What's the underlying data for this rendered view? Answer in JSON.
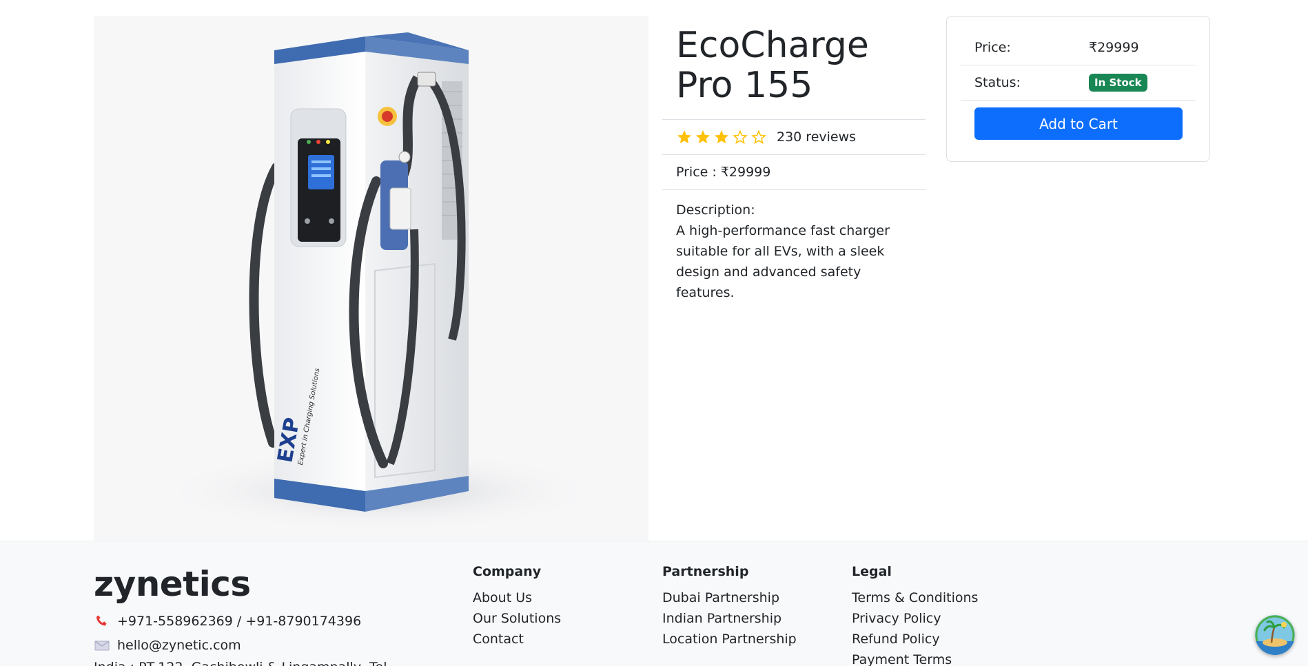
{
  "product": {
    "title": "EcoCharge Pro 155",
    "rating": 3,
    "rating_max": 5,
    "reviews_text": "230 reviews",
    "price_line": "Price : ₹29999",
    "description_label": "Description:",
    "description": "A high-performance fast charger suitable for all EVs, with a sleek design and advanced safety features.",
    "image_text": "EXP Expert in Charging Solutions"
  },
  "buy_box": {
    "price_label": "Price:",
    "price_value": "₹29999",
    "status_label": "Status:",
    "status_value": "In Stock",
    "add_to_cart": "Add to Cart"
  },
  "footer": {
    "brand": "zynetics",
    "phone": "+971-558962369 / +91-8790174396",
    "email": "hello@zynetic.com",
    "address": "India : PT-122, Gachibowli & Lingampally, Tel...",
    "company": {
      "heading": "Company",
      "links": [
        "About Us",
        "Our Solutions",
        "Contact"
      ]
    },
    "partnership": {
      "heading": "Partnership",
      "links": [
        "Dubai Partnership",
        "Indian Partnership",
        "Location Partnership"
      ]
    },
    "legal": {
      "heading": "Legal",
      "links": [
        "Terms & Conditions",
        "Privacy Policy",
        "Refund Policy",
        "Payment Terms"
      ]
    }
  },
  "colors": {
    "star": "#ffc107",
    "primary": "#0d6efd",
    "success": "#198754",
    "footer_bg": "#f8f9fa"
  },
  "icons": {
    "phone": "phone-icon",
    "email": "envelope-icon",
    "assistant": "tropical-island-icon"
  }
}
